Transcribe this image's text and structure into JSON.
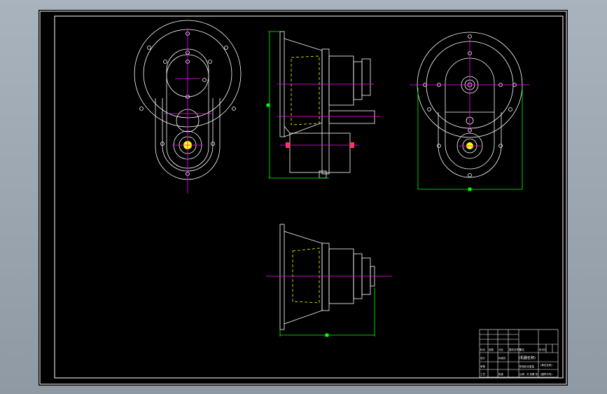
{
  "drawing": {
    "colors": {
      "background": "#000000",
      "outline": "#ffffff",
      "centerline": "#ff00ff",
      "dimension": "#00ff00",
      "hidden": "#ffff00",
      "highlight": "#ffff00",
      "accent": "#ff4040"
    },
    "views": [
      "front-view",
      "side-section-view",
      "rear-view",
      "top-view"
    ],
    "title_block": {
      "drawing_title": "(机器名称)",
      "company": "(单位名称)",
      "drawing_number": "(图样代号)",
      "header_cells": [
        "标记",
        "处数",
        "分区",
        "更改文件号",
        "签名",
        "年月日"
      ],
      "role_cells": [
        "设计",
        "标准化",
        "审核",
        "工艺",
        "批准"
      ],
      "stage_cells": [
        "阶段标记",
        "重量",
        "比例"
      ],
      "sheet_cells": [
        "共 张",
        "第 张"
      ]
    }
  }
}
